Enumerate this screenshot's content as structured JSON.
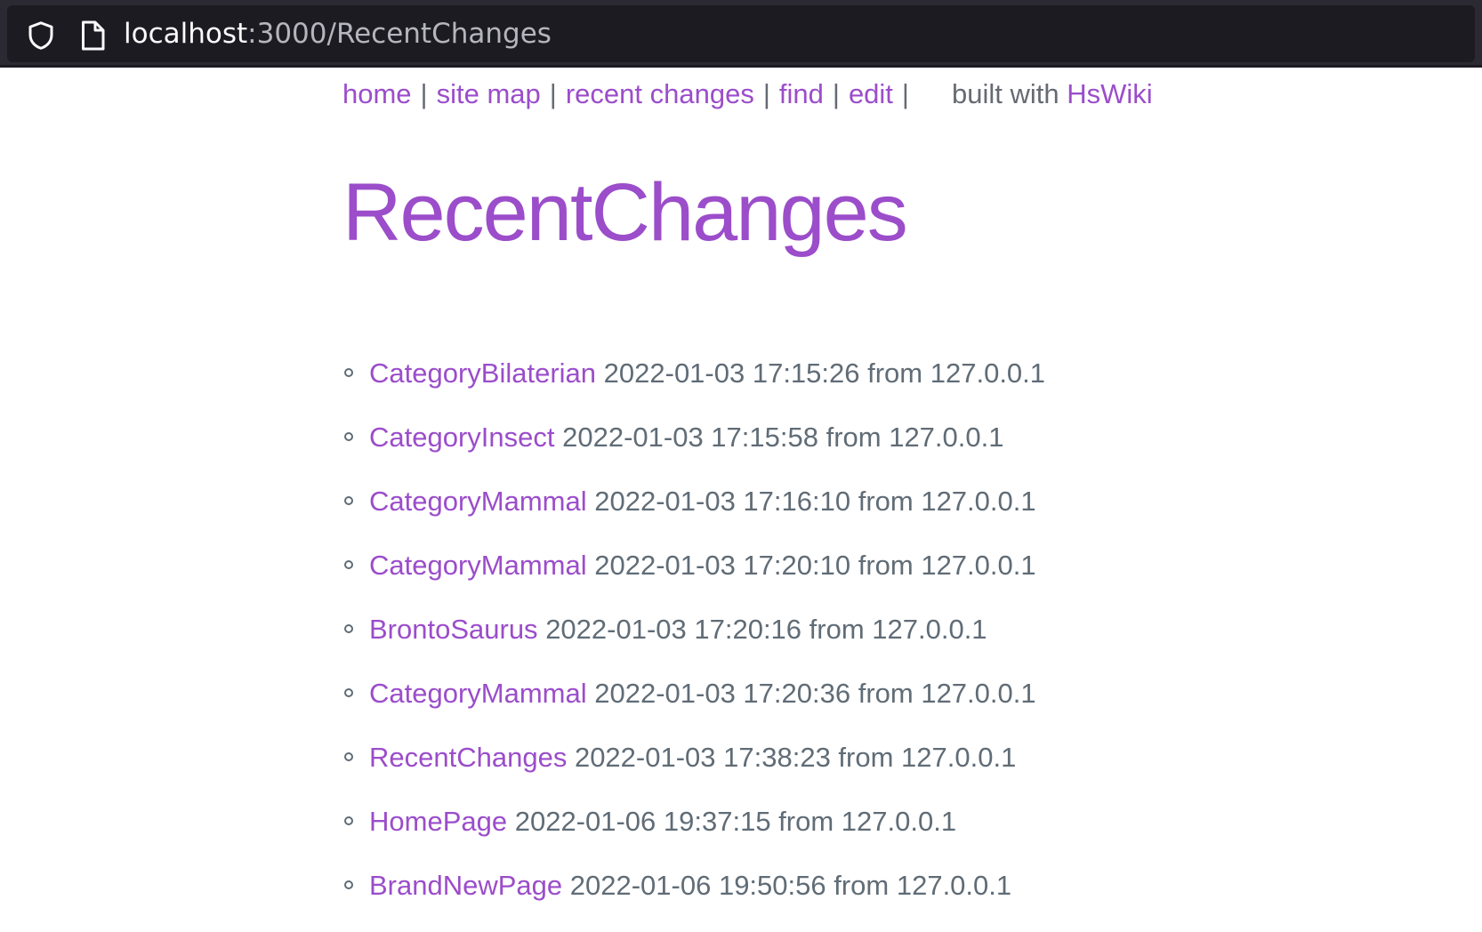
{
  "browser": {
    "url_host": "localhost",
    "url_rest": ":3000/RecentChanges"
  },
  "nav": {
    "home": "home",
    "site_map": "site map",
    "recent_changes": "recent changes",
    "find": "find",
    "edit": "edit",
    "separator": "|",
    "built_with": "built with",
    "hswiki": "HsWiki"
  },
  "page": {
    "title": "RecentChanges"
  },
  "changes": [
    {
      "page": "CategoryBilaterian",
      "info": "2022-01-03 17:15:26 from 127.0.0.1"
    },
    {
      "page": "CategoryInsect",
      "info": "2022-01-03 17:15:58 from 127.0.0.1"
    },
    {
      "page": "CategoryMammal",
      "info": "2022-01-03 17:16:10 from 127.0.0.1"
    },
    {
      "page": "CategoryMammal",
      "info": "2022-01-03 17:20:10 from 127.0.0.1"
    },
    {
      "page": "BrontoSaurus",
      "info": "2022-01-03 17:20:16 from 127.0.0.1"
    },
    {
      "page": "CategoryMammal",
      "info": "2022-01-03 17:20:36 from 127.0.0.1"
    },
    {
      "page": "RecentChanges",
      "info": "2022-01-03 17:38:23 from 127.0.0.1"
    },
    {
      "page": "HomePage",
      "info": "2022-01-06 19:37:15 from 127.0.0.1"
    },
    {
      "page": "BrandNewPage",
      "info": "2022-01-06 19:50:56 from 127.0.0.1"
    }
  ],
  "colors": {
    "link": "#9b4dca",
    "text": "#606c76",
    "toolbar": "#1c1b22"
  },
  "icons": {
    "tracking_protection": "shield-icon",
    "page_info": "page-icon"
  }
}
